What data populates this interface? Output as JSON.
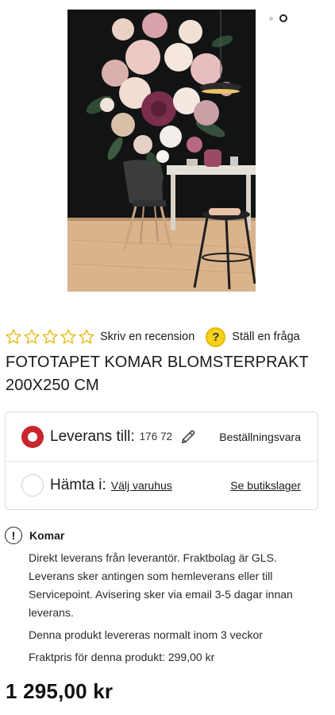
{
  "gallery": {
    "image_alt": "Fototapet med blomsterbukett",
    "slide_count": 2,
    "active_slide": 2
  },
  "reviews": {
    "star_count": 5,
    "filled_stars": 0,
    "write_review": "Skriv en recension",
    "ask_question_icon": "?",
    "ask_question": "Ställ en fråga"
  },
  "product": {
    "title": "FOTOTAPET KOMAR BLOMSTERPRAKT 200X250 CM",
    "price": "1 295,00 kr"
  },
  "delivery": {
    "ship_label": "Leverans till:",
    "zip": "176 72",
    "ship_status": "Beställningsvara",
    "pickup_label": "Hämta i:",
    "pickup_store": "Välj varuhus",
    "stock_link": "Se butikslager"
  },
  "info": {
    "icon": "!",
    "brand": "Komar",
    "text1": "Direkt leverans från leverantör. Fraktbolag är GLS. Leverans sker antingen som hemleverans eller till Servicepoint. Avisering sker via email 3-5 dagar innan leverans.",
    "text2": "Denna produkt levereras normalt inom 3 veckor",
    "text3": "Fraktpris för denna produkt: 299,00 kr"
  },
  "colors": {
    "accent_red": "#c8262c",
    "star_outline": "#e2b500",
    "question_yellow": "#f7d21b"
  }
}
